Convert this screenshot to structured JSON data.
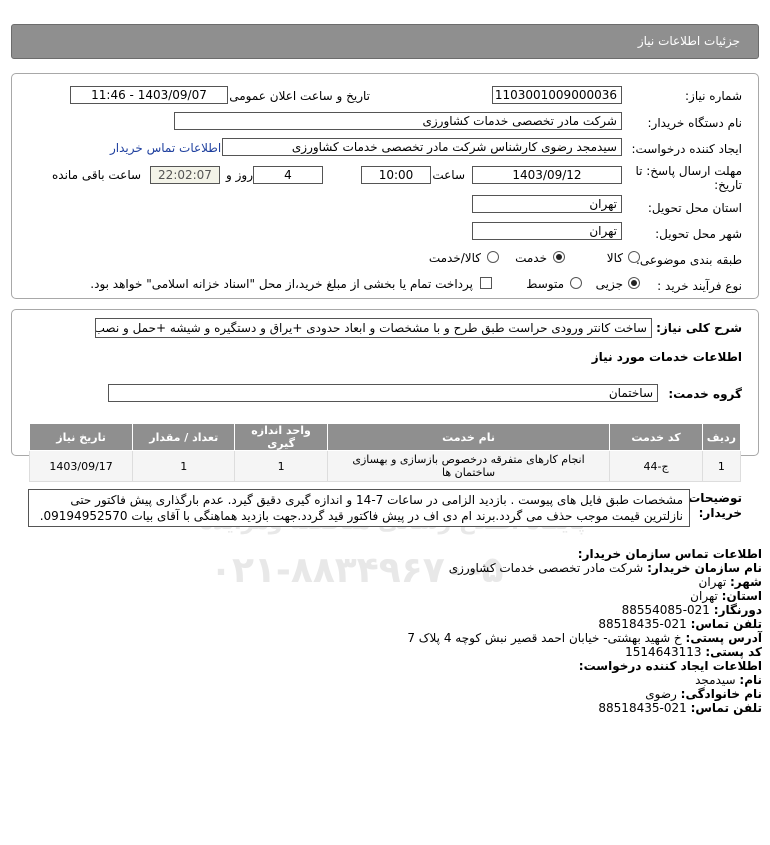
{
  "header": {
    "title": "جزئیات اطلاعات نیاز"
  },
  "form": {
    "need_number_label": "شماره نیاز:",
    "need_number": "1103001009000036",
    "announce_label": "تاریخ و ساعت اعلان عمومی:",
    "announce_value": "1403/09/07 - 11:46",
    "buyer_org_label": "نام دستگاه خریدار:",
    "buyer_org": "شرکت مادر تخصصی خدمات کشاورزی",
    "creator_label": "ایجاد کننده درخواست:",
    "creator": "سیدمجد رضوی کارشناس شرکت مادر تخصصی خدمات کشاورزی",
    "buyer_contact_link": "اطلاعات تماس خریدار",
    "deadline_label": "مهلت ارسال پاسخ: تا تاریخ:",
    "deadline_date": "1403/09/12",
    "time_label": "ساعت",
    "deadline_time": "10:00",
    "days_value": "4",
    "days_label": "روز و",
    "remaining_time": "22:02:07",
    "remaining_label": "ساعت باقی مانده",
    "province_label": "استان محل تحویل:",
    "province": "تهران",
    "city_label": "شهر محل تحویل:",
    "city": "تهران",
    "category_label": "طبقه بندی موضوعی:",
    "category_options": [
      "کالا",
      "خدمت",
      "کالا/خدمت"
    ],
    "process_label": "نوع فرآیند خرید :",
    "process_options": [
      "جزیی",
      "متوسط"
    ],
    "payment_note": "پرداخت تمام یا بخشی از مبلغ خرید،از محل \"اسناد خزانه اسلامی\" خواهد بود."
  },
  "description": {
    "label": "شرح کلی نیاز:",
    "text": "ساخت کانتر ورودی حراست طبق طرح و با مشخصات و ابعاد حدودی +یراق و دستگیره و شیشه +حمل و نصب",
    "services_heading": "اطلاعات خدمات مورد نیاز",
    "group_label": "گروه خدمت:",
    "group_value": "ساختمان"
  },
  "table": {
    "headers": [
      "ردیف",
      "کد خدمت",
      "نام خدمت",
      "واحد اندازه گیری",
      "تعداد / مقدار",
      "تاریخ نیاز"
    ],
    "rows": [
      [
        "1",
        "ج-44",
        "انجام کارهای متفرقه درخصوص بازسازی و بهسازی ساختمان ها",
        "1",
        "1",
        "1403/09/17"
      ]
    ]
  },
  "notes": {
    "label": "توضیحات خریدار:",
    "line1": "مشخصات طبق فایل های پیوست . بازدید الزامی در ساعات 7-14 و اندازه گیری دقیق گیرد. عدم بارگذاری پیش فاکتور حتی",
    "line2": "نازلترین قیمت موجب حذف می گردد.برند ام دی اف در پیش فاکتور قید گردد.جهت بازدید هماهنگی با آقای بیات 09194952570."
  },
  "contact": {
    "heading": "اطلاعات تماس سازمان خریدار:",
    "org_label": "نام سازمان خریدار:",
    "org": "شرکت مادر تخصصی خدمات کشاورزی",
    "city_label": "شهر:",
    "city": "تهران",
    "province_label": "استان:",
    "province": "تهران",
    "fax_label": "دورنگار:",
    "fax": "021-88554085",
    "phone_label": "تلفن تماس:",
    "phone": "021-88518435",
    "address_label": "آدرس پستی:",
    "address": "خ شهید بهشتی- خیابان احمد قصیر نبش کوچه 4 پلاک 7",
    "postal_label": "کد پستی:",
    "postal": "1514643113",
    "creator_heading": "اطلاعات ایجاد کننده درخواست:",
    "first_name_label": "نام:",
    "first_name": "سیدمجد",
    "last_name_label": "نام خانوادگی:",
    "last_name": "رضوی",
    "creator_phone_label": "تلفن تماس:",
    "creator_phone": "021-88518435"
  },
  "watermark": {
    "brand": "ParsNamadData",
    "tagline": "پایگاه اطلاع رسانی مناقصه ومزایده",
    "phone": "۰۲۱-۸۸۳۴۹۶۷۰-۵"
  }
}
